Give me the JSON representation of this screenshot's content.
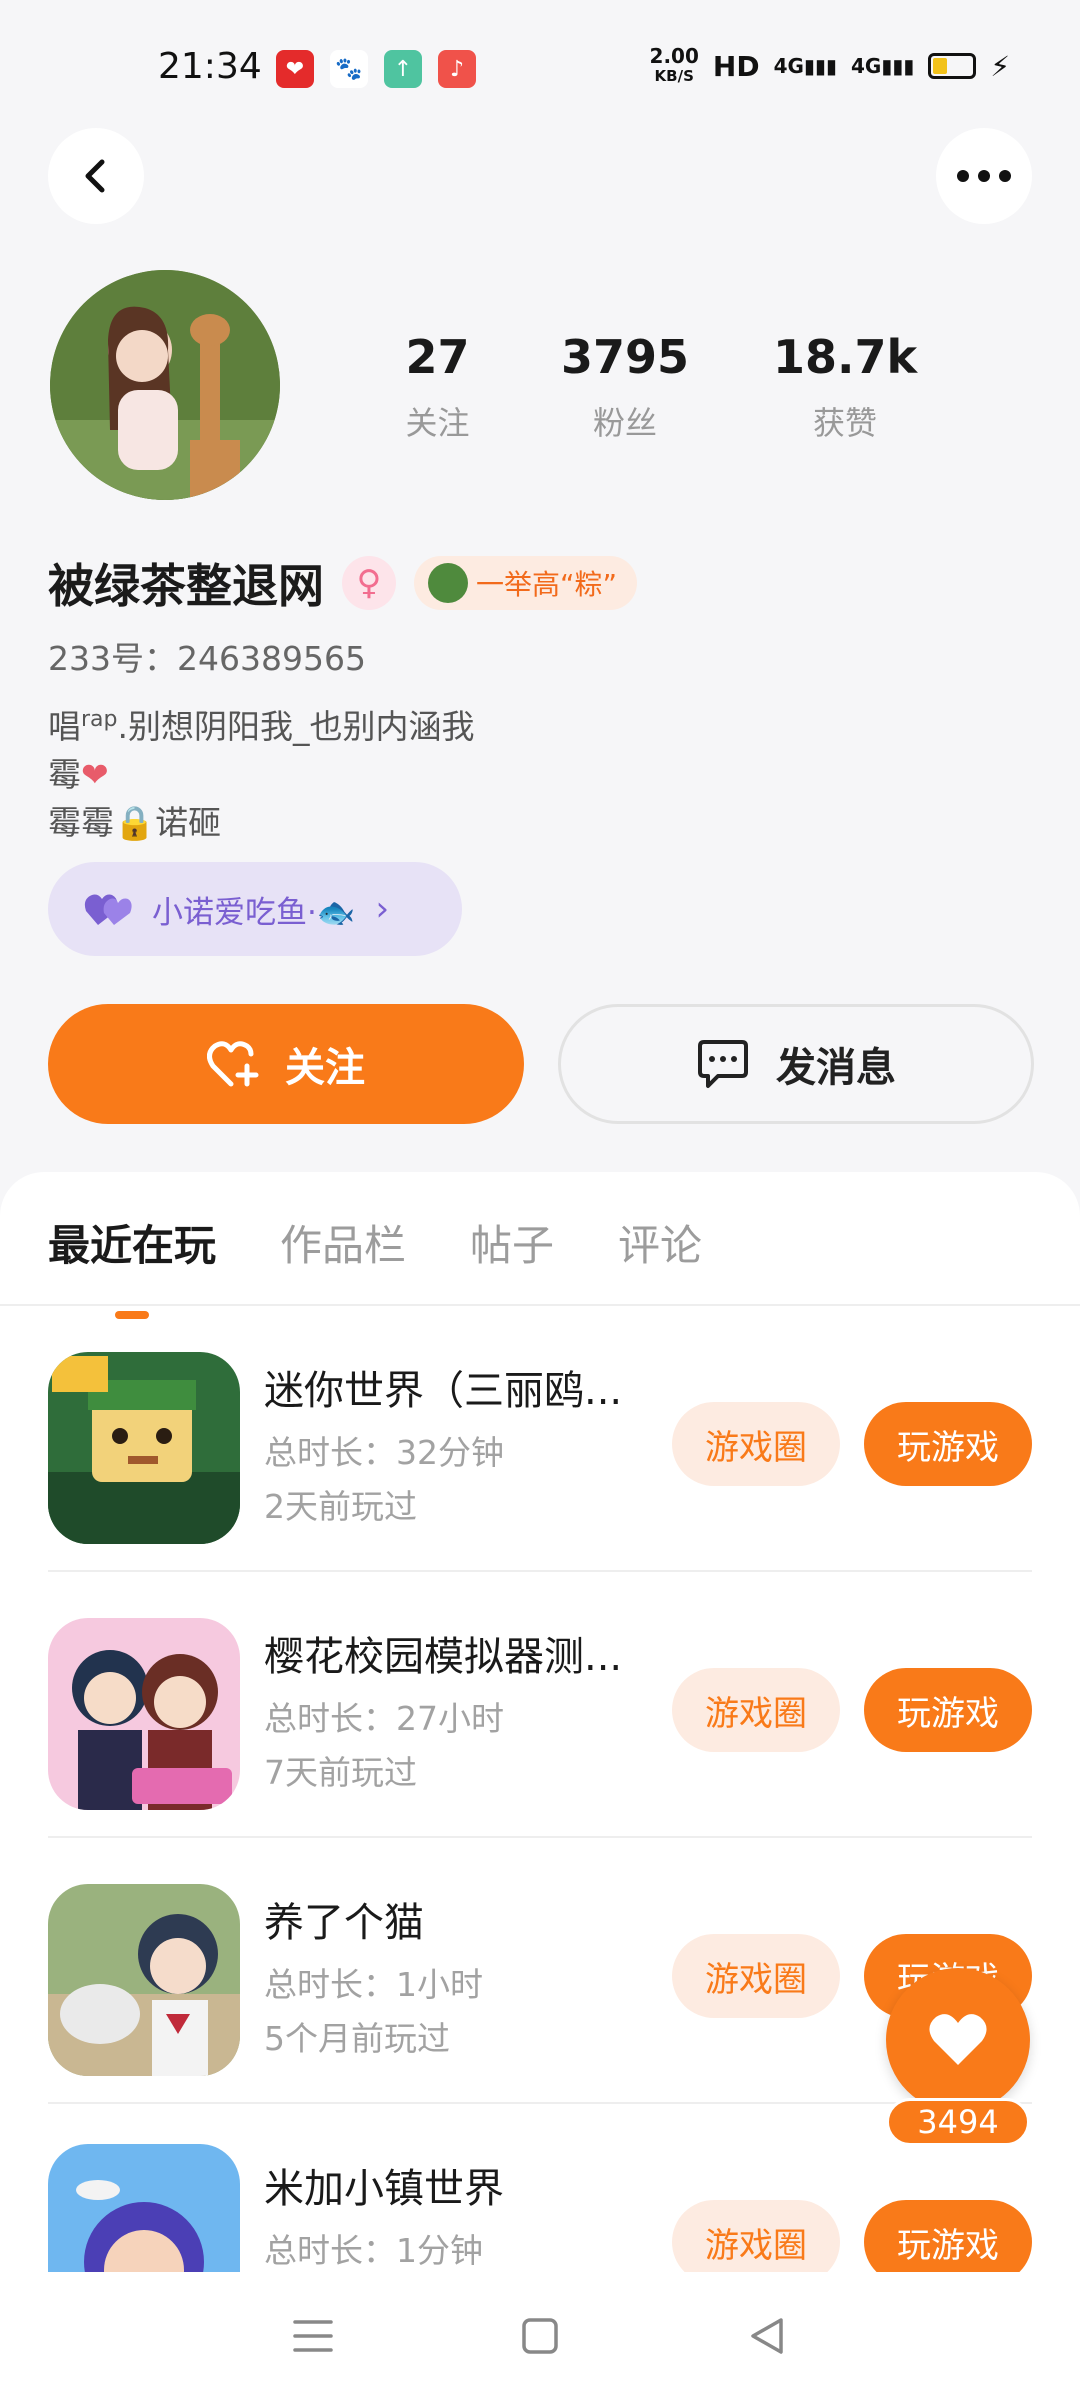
{
  "status_bar": {
    "time": "21:34",
    "net_speed_value": "2.00",
    "net_speed_unit": "KB/S",
    "hd": "HD",
    "signal1": "4G",
    "signal2": "4G",
    "battery_color": "#f2c21b"
  },
  "profile": {
    "stats": [
      {
        "value": "27",
        "label": "关注"
      },
      {
        "value": "3795",
        "label": "粉丝"
      },
      {
        "value": "18.7k",
        "label": "获赞"
      }
    ],
    "name": "被绿茶整退网",
    "badge": "一举高“粽”",
    "uid": "233号：246389565",
    "bio_line1_a": "唱",
    "bio_line1_sup": "rap",
    "bio_line1_b": ".别想阴阳我_也别内涵我",
    "bio_line2": "霉",
    "bio_line3_a": "霉霉",
    "bio_line3_b": "诺砸",
    "relation_label": "小诺爱吃鱼·🐟"
  },
  "actions": {
    "follow": "关注",
    "message": "发消息"
  },
  "tabs": [
    "最近在玩",
    "作品栏",
    "帖子",
    "评论"
  ],
  "games": [
    {
      "title": "迷你世界（三丽鸥...",
      "duration": "总时长：32分钟",
      "last_played": "2天前玩过",
      "circle": "游戏圈",
      "play": "玩游戏"
    },
    {
      "title": "樱花校园模拟器测...",
      "duration": "总时长：27小时",
      "last_played": "7天前玩过",
      "circle": "游戏圈",
      "play": "玩游戏"
    },
    {
      "title": "养了个猫",
      "duration": "总时长：1小时",
      "last_played": "5个月前玩过",
      "circle": "游戏圈",
      "play": "玩游戏"
    },
    {
      "title": "米加小镇世界",
      "duration": "总时长：1分钟",
      "last_played": "",
      "circle": "游戏圈",
      "play": "玩游戏"
    }
  ],
  "floating_like": {
    "count": "3494"
  },
  "colors": {
    "accent": "#f97a19",
    "relation_purple": "#7a5fd1"
  }
}
